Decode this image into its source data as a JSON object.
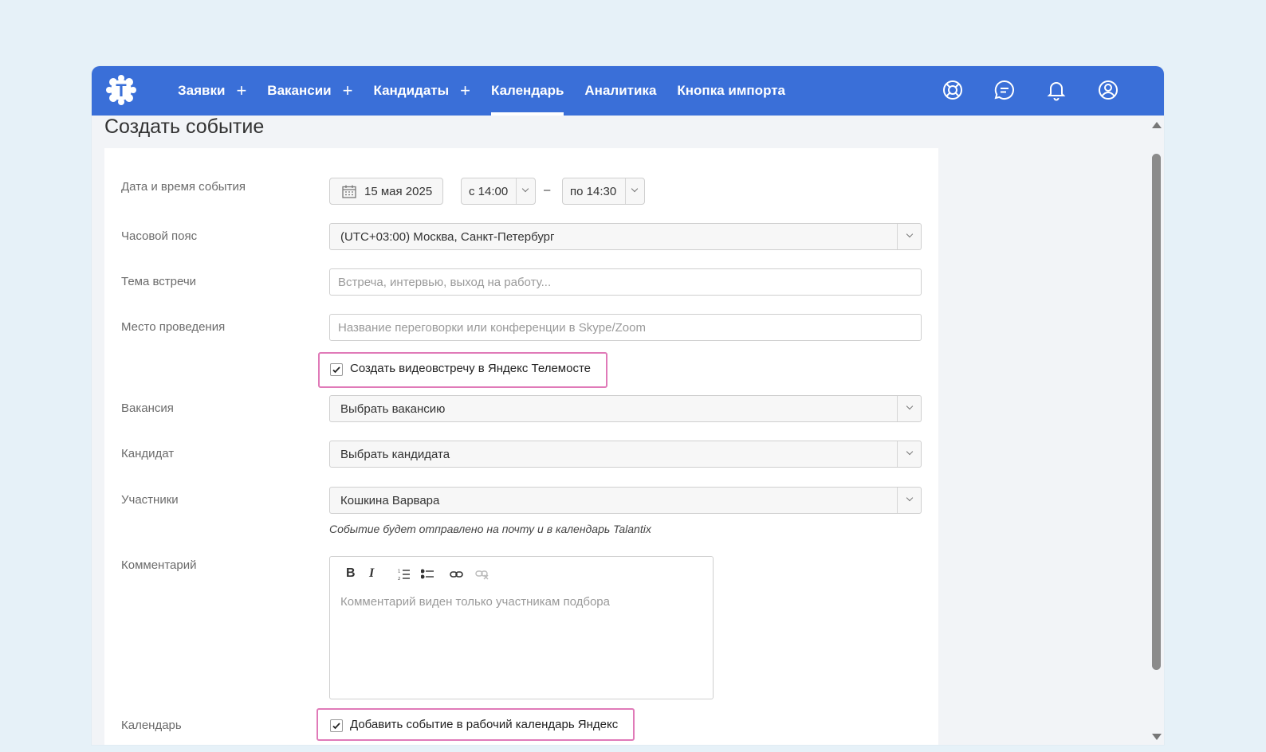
{
  "nav": {
    "items": [
      {
        "label": "Заявки",
        "plus": "+"
      },
      {
        "label": "Вакансии",
        "plus": "+"
      },
      {
        "label": "Кандидаты",
        "plus": "+"
      },
      {
        "label": "Календарь"
      },
      {
        "label": "Аналитика"
      },
      {
        "label": "Кнопка импорта"
      }
    ],
    "active": "Календарь",
    "icons": [
      "support-icon",
      "chat-icon",
      "bell-icon",
      "profile-icon"
    ],
    "accent": "#3a6fd8"
  },
  "logo_letter": "T",
  "page": {
    "title": "Создать событие"
  },
  "form": {
    "datetime": {
      "label": "Дата и время события",
      "date": "15 мая 2025",
      "from": "с 14:00",
      "dash": "–",
      "to": "по 14:30"
    },
    "timezone": {
      "label": "Часовой пояс",
      "value": "(UTC+03:00) Москва, Санкт-Петербург"
    },
    "topic": {
      "label": "Тема встречи",
      "placeholder": "Встреча, интервью, выход на работу..."
    },
    "place": {
      "label": "Место проведения",
      "placeholder": "Название переговорки или конференции в Skype/Zoom"
    },
    "video": {
      "label": "Создать видеовстречу в Яндекс Телемосте",
      "checked": true
    },
    "vacancy": {
      "label": "Вакансия",
      "value": "Выбрать вакансию"
    },
    "candidate": {
      "label": "Кандидат",
      "value": "Выбрать кандидата"
    },
    "participants": {
      "label": "Участники",
      "value": "Кошкина Варвара",
      "note": "Событие будет отправлено на почту и в календарь Talantix"
    },
    "comment": {
      "label": "Комментарий",
      "placeholder": "Комментарий виден только участникам подбора",
      "toolbar": {
        "bold": "B",
        "italic": "I"
      }
    },
    "calendar": {
      "label": "Календарь",
      "checkbox_label": "Добавить событие в рабочий календарь Яндекс",
      "checked": true
    }
  },
  "highlight_color": "#e07ab8"
}
